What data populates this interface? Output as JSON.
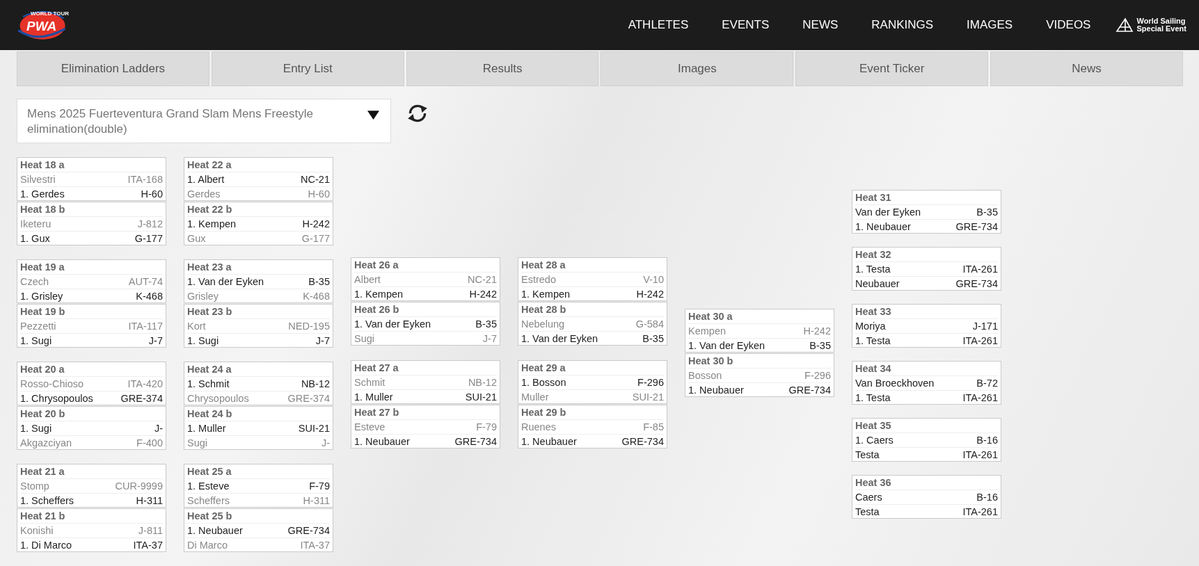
{
  "header": {
    "logo": {
      "small_text": "WORLD TOUR",
      "text": "PWA"
    },
    "nav": [
      "ATHLETES",
      "EVENTS",
      "NEWS",
      "RANKINGS",
      "IMAGES",
      "VIDEOS"
    ],
    "partner": {
      "line_1": "World Sailing",
      "line_2": "Special Event"
    }
  },
  "tabs": [
    {
      "label": "Elimination Ladders",
      "selected": false
    },
    {
      "label": "Entry List",
      "selected": false
    },
    {
      "label": "Results",
      "selected": false
    },
    {
      "label": "Images",
      "selected": false
    },
    {
      "label": "Event Ticker",
      "selected": false
    },
    {
      "label": "News",
      "selected": false
    }
  ],
  "event_select": {
    "value": "Mens 2025 Fuerteventura Grand Slam Mens Freestyle elimination(double)"
  },
  "rounds": [
    {
      "groups": [
        {
          "heats": [
            {
              "title": "Heat 18 a",
              "riders": [
                {
                  "name": "Silvestri",
                  "sail": "ITA-168",
                  "winner": false
                },
                {
                  "name": "1. Gerdes",
                  "sail": "H-60",
                  "winner": true
                }
              ]
            },
            {
              "title": "Heat 18 b",
              "riders": [
                {
                  "name": "Iketeru",
                  "sail": "J-812",
                  "winner": false
                },
                {
                  "name": "1. Gux",
                  "sail": "G-177",
                  "winner": true
                }
              ]
            }
          ]
        },
        {
          "heats": [
            {
              "title": "Heat 19 a",
              "riders": [
                {
                  "name": "Czech",
                  "sail": "AUT-74",
                  "winner": false
                },
                {
                  "name": "1. Grisley",
                  "sail": "K-468",
                  "winner": true
                }
              ]
            },
            {
              "title": "Heat 19 b",
              "riders": [
                {
                  "name": "Pezzetti",
                  "sail": "ITA-117",
                  "winner": false
                },
                {
                  "name": "1. Sugi",
                  "sail": "J-7",
                  "winner": true
                }
              ]
            }
          ]
        },
        {
          "heats": [
            {
              "title": "Heat 20 a",
              "riders": [
                {
                  "name": "Rosso-Chioso",
                  "sail": "ITA-420",
                  "winner": false
                },
                {
                  "name": "1. Chrysopoulos",
                  "sail": "GRE-374",
                  "winner": true
                }
              ]
            },
            {
              "title": "Heat 20 b",
              "riders": [
                {
                  "name": "1. Sugi",
                  "sail": "J-",
                  "winner": true
                },
                {
                  "name": "Akgazciyan",
                  "sail": "F-400",
                  "winner": false
                }
              ]
            }
          ]
        },
        {
          "heats": [
            {
              "title": "Heat 21 a",
              "riders": [
                {
                  "name": "Stomp",
                  "sail": "CUR-9999",
                  "winner": false
                },
                {
                  "name": "1. Scheffers",
                  "sail": "H-311",
                  "winner": true
                }
              ]
            },
            {
              "title": "Heat 21 b",
              "riders": [
                {
                  "name": "Konishi",
                  "sail": "J-811",
                  "winner": false
                },
                {
                  "name": "1. Di Marco",
                  "sail": "ITA-37",
                  "winner": true
                }
              ]
            }
          ]
        }
      ]
    },
    {
      "groups": [
        {
          "heats": [
            {
              "title": "Heat 22 a",
              "riders": [
                {
                  "name": "1. Albert",
                  "sail": "NC-21",
                  "winner": true
                },
                {
                  "name": "Gerdes",
                  "sail": "H-60",
                  "winner": false
                }
              ]
            },
            {
              "title": "Heat 22 b",
              "riders": [
                {
                  "name": "1. Kempen",
                  "sail": "H-242",
                  "winner": true
                },
                {
                  "name": "Gux",
                  "sail": "G-177",
                  "winner": false
                }
              ]
            }
          ]
        },
        {
          "heats": [
            {
              "title": "Heat 23 a",
              "riders": [
                {
                  "name": "1. Van der Eyken",
                  "sail": "B-35",
                  "winner": true
                },
                {
                  "name": "Grisley",
                  "sail": "K-468",
                  "winner": false
                }
              ]
            },
            {
              "title": "Heat 23 b",
              "riders": [
                {
                  "name": "Kort",
                  "sail": "NED-195",
                  "winner": false
                },
                {
                  "name": "1. Sugi",
                  "sail": "J-7",
                  "winner": true
                }
              ]
            }
          ]
        },
        {
          "heats": [
            {
              "title": "Heat 24 a",
              "riders": [
                {
                  "name": "1. Schmit",
                  "sail": "NB-12",
                  "winner": true
                },
                {
                  "name": "Chrysopoulos",
                  "sail": "GRE-374",
                  "winner": false
                }
              ]
            },
            {
              "title": "Heat 24 b",
              "riders": [
                {
                  "name": "1. Muller",
                  "sail": "SUI-21",
                  "winner": true
                },
                {
                  "name": "Sugi",
                  "sail": "J-",
                  "winner": false
                }
              ]
            }
          ]
        },
        {
          "heats": [
            {
              "title": "Heat 25 a",
              "riders": [
                {
                  "name": "1. Esteve",
                  "sail": "F-79",
                  "winner": true
                },
                {
                  "name": "Scheffers",
                  "sail": "H-311",
                  "winner": false
                }
              ]
            },
            {
              "title": "Heat 25 b",
              "riders": [
                {
                  "name": "1. Neubauer",
                  "sail": "GRE-734",
                  "winner": true
                },
                {
                  "name": "Di Marco",
                  "sail": "ITA-37",
                  "winner": false
                }
              ]
            }
          ]
        }
      ]
    },
    {
      "groups": [
        {
          "heats": [
            {
              "title": "Heat 26 a",
              "riders": [
                {
                  "name": "Albert",
                  "sail": "NC-21",
                  "winner": false
                },
                {
                  "name": "1. Kempen",
                  "sail": "H-242",
                  "winner": true
                }
              ]
            },
            {
              "title": "Heat 26 b",
              "riders": [
                {
                  "name": "1. Van der Eyken",
                  "sail": "B-35",
                  "winner": true
                },
                {
                  "name": "Sugi",
                  "sail": "J-7",
                  "winner": false
                }
              ]
            }
          ]
        },
        {
          "heats": [
            {
              "title": "Heat 27 a",
              "riders": [
                {
                  "name": "Schmit",
                  "sail": "NB-12",
                  "winner": false
                },
                {
                  "name": "1. Muller",
                  "sail": "SUI-21",
                  "winner": true
                }
              ]
            },
            {
              "title": "Heat 27 b",
              "riders": [
                {
                  "name": "Esteve",
                  "sail": "F-79",
                  "winner": false
                },
                {
                  "name": "1. Neubauer",
                  "sail": "GRE-734",
                  "winner": true
                }
              ]
            }
          ]
        }
      ]
    },
    {
      "groups": [
        {
          "heats": [
            {
              "title": "Heat 28 a",
              "riders": [
                {
                  "name": "Estredo",
                  "sail": "V-10",
                  "winner": false
                },
                {
                  "name": "1. Kempen",
                  "sail": "H-242",
                  "winner": true
                }
              ]
            },
            {
              "title": "Heat 28 b",
              "riders": [
                {
                  "name": "Nebelung",
                  "sail": "G-584",
                  "winner": false
                },
                {
                  "name": "1. Van der Eyken",
                  "sail": "B-35",
                  "winner": true
                }
              ]
            }
          ]
        },
        {
          "heats": [
            {
              "title": "Heat 29 a",
              "riders": [
                {
                  "name": "1. Bosson",
                  "sail": "F-296",
                  "winner": true
                },
                {
                  "name": "Muller",
                  "sail": "SUI-21",
                  "winner": false
                }
              ]
            },
            {
              "title": "Heat 29 b",
              "riders": [
                {
                  "name": "Ruenes",
                  "sail": "F-85",
                  "winner": false
                },
                {
                  "name": "1. Neubauer",
                  "sail": "GRE-734",
                  "winner": true
                }
              ]
            }
          ]
        }
      ]
    },
    {
      "groups": [
        {
          "heats": [
            {
              "title": "Heat 30 a",
              "riders": [
                {
                  "name": "Kempen",
                  "sail": "H-242",
                  "winner": false
                },
                {
                  "name": "1. Van der Eyken",
                  "sail": "B-35",
                  "winner": true
                }
              ]
            },
            {
              "title": "Heat 30 b",
              "riders": [
                {
                  "name": "Bosson",
                  "sail": "F-296",
                  "winner": false
                },
                {
                  "name": "1. Neubauer",
                  "sail": "GRE-734",
                  "winner": true
                }
              ]
            }
          ]
        }
      ]
    },
    {
      "groups": [
        {
          "heats": [
            {
              "title": "Heat 31",
              "riders": [
                {
                  "name": "Van der Eyken",
                  "sail": "B-35",
                  "winner": true
                },
                {
                  "name": "1. Neubauer",
                  "sail": "GRE-734",
                  "winner": true
                }
              ]
            }
          ]
        },
        {
          "heats": [
            {
              "title": "Heat 32",
              "riders": [
                {
                  "name": "1. Testa",
                  "sail": "ITA-261",
                  "winner": true
                },
                {
                  "name": "Neubauer",
                  "sail": "GRE-734",
                  "winner": true
                }
              ]
            }
          ]
        },
        {
          "heats": [
            {
              "title": "Heat 33",
              "riders": [
                {
                  "name": "Moriya",
                  "sail": "J-171",
                  "winner": true
                },
                {
                  "name": "1. Testa",
                  "sail": "ITA-261",
                  "winner": true
                }
              ]
            }
          ]
        },
        {
          "heats": [
            {
              "title": "Heat 34",
              "riders": [
                {
                  "name": "Van Broeckhoven",
                  "sail": "B-72",
                  "winner": true
                },
                {
                  "name": "1. Testa",
                  "sail": "ITA-261",
                  "winner": true
                }
              ]
            }
          ]
        },
        {
          "heats": [
            {
              "title": "Heat 35",
              "riders": [
                {
                  "name": "1. Caers",
                  "sail": "B-16",
                  "winner": true
                },
                {
                  "name": "Testa",
                  "sail": "ITA-261",
                  "winner": true
                }
              ]
            }
          ]
        },
        {
          "heats": [
            {
              "title": "Heat 36",
              "riders": [
                {
                  "name": "Caers",
                  "sail": "B-16",
                  "winner": true
                },
                {
                  "name": "Testa",
                  "sail": "ITA-261",
                  "winner": true
                }
              ]
            }
          ]
        }
      ]
    }
  ]
}
